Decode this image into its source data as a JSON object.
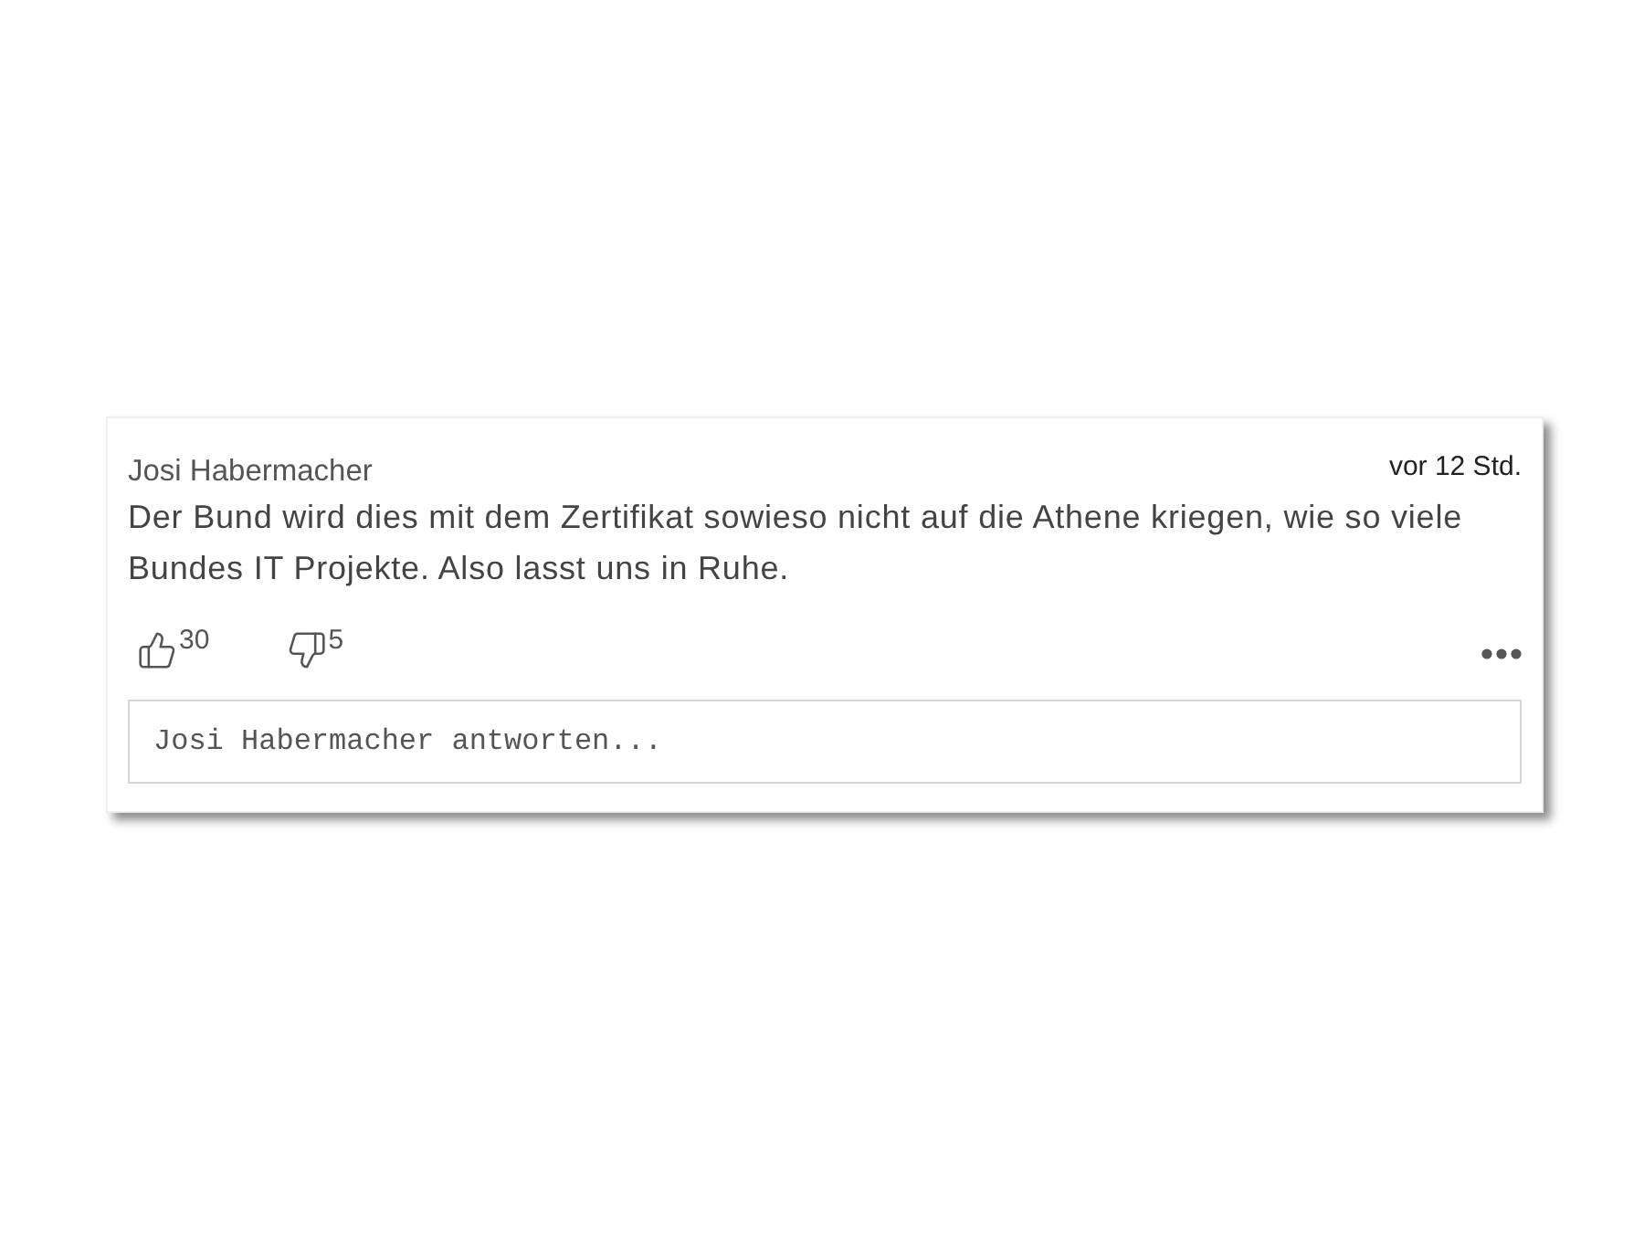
{
  "comment": {
    "author": "Josi Habermacher",
    "time": "vor 12 Std.",
    "text": "Der Bund wird dies mit dem Zertifikat sowieso nicht auf die Athene kriegen, wie so viele Bundes IT Projekte. Also lasst uns in Ruhe.",
    "votes": [
      {
        "kind": "up",
        "count": "30"
      },
      {
        "kind": "down",
        "count": "5"
      }
    ]
  },
  "reply": {
    "placeholder": "Josi Habermacher antworten..."
  }
}
